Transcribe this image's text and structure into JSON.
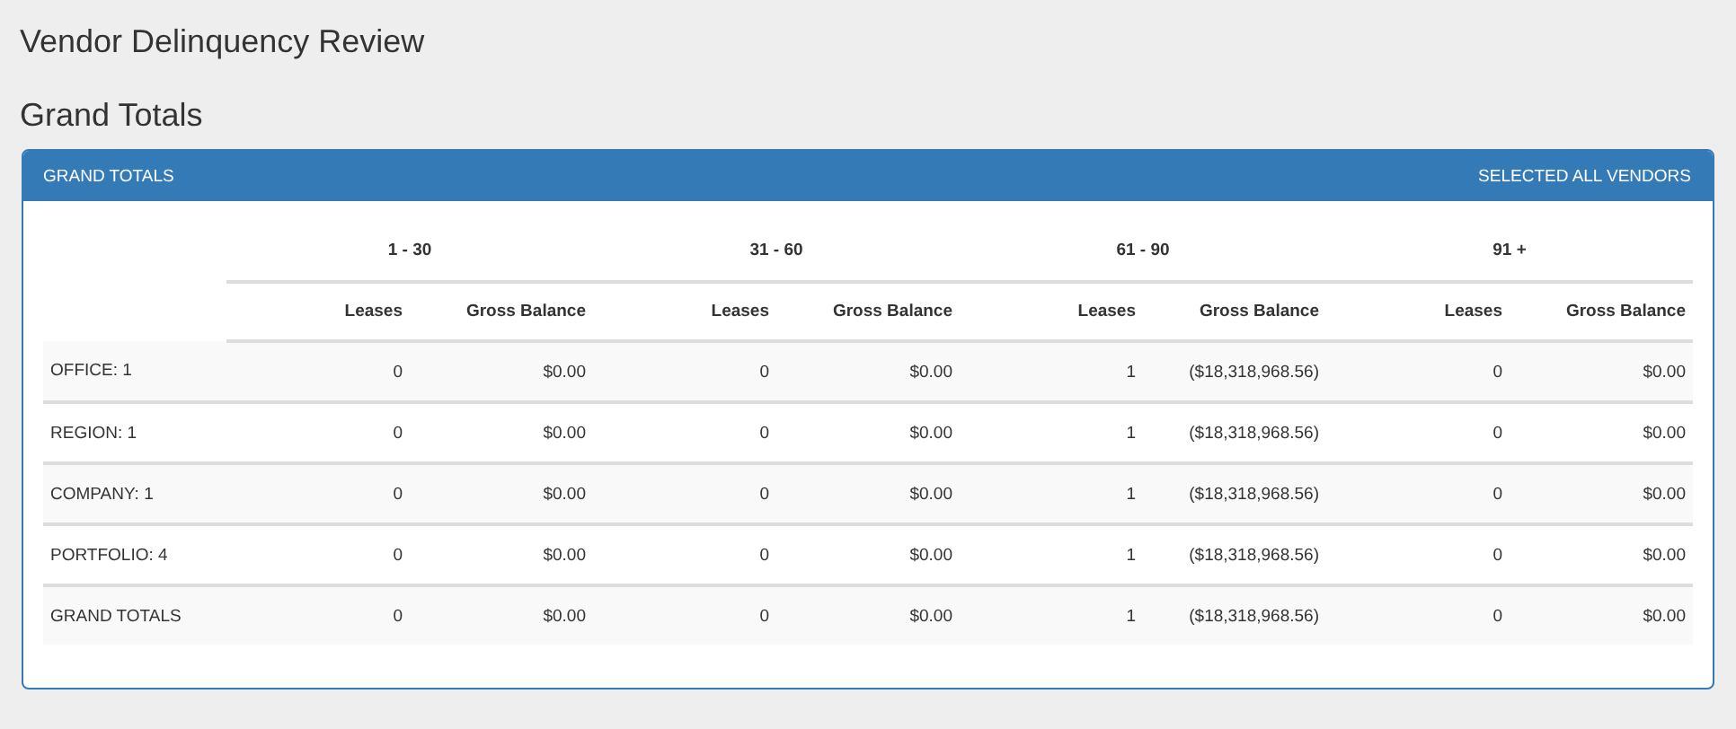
{
  "page_title": "Vendor Delinquency Review",
  "section_title": "Grand Totals",
  "panel": {
    "title": "GRAND TOTALS",
    "subtitle": "SELECTED ALL VENDORS",
    "table": {
      "groups": [
        "1 - 30",
        "31 - 60",
        "61 - 90",
        "91 +"
      ],
      "columns": [
        "Leases",
        "Gross Balance",
        "Leases",
        "Gross Balance",
        "Leases",
        "Gross Balance",
        "Leases",
        "Gross Balance"
      ],
      "rows": [
        {
          "label": "OFFICE: 1",
          "cells": [
            "0",
            "$0.00",
            "0",
            "$0.00",
            "1",
            "($18,318,968.56)",
            "0",
            "$0.00"
          ]
        },
        {
          "label": "REGION: 1",
          "cells": [
            "0",
            "$0.00",
            "0",
            "$0.00",
            "1",
            "($18,318,968.56)",
            "0",
            "$0.00"
          ]
        },
        {
          "label": "COMPANY: 1",
          "cells": [
            "0",
            "$0.00",
            "0",
            "$0.00",
            "1",
            "($18,318,968.56)",
            "0",
            "$0.00"
          ]
        },
        {
          "label": "PORTFOLIO: 4",
          "cells": [
            "0",
            "$0.00",
            "0",
            "$0.00",
            "1",
            "($18,318,968.56)",
            "0",
            "$0.00"
          ]
        },
        {
          "label": "GRAND TOTALS",
          "cells": [
            "0",
            "$0.00",
            "0",
            "$0.00",
            "1",
            "($18,318,968.56)",
            "0",
            "$0.00"
          ]
        }
      ]
    }
  }
}
